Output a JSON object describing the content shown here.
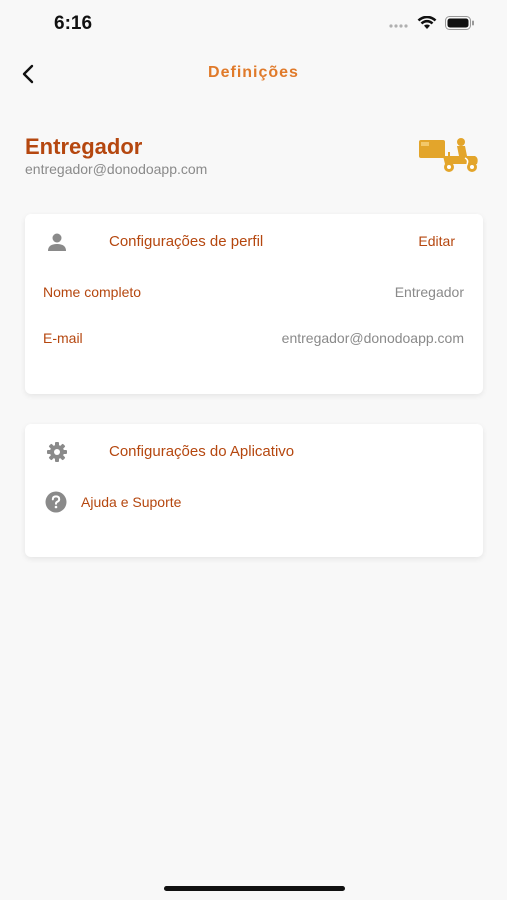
{
  "status_bar": {
    "time": "6:16"
  },
  "header": {
    "title": "Definições"
  },
  "profile": {
    "name": "Entregador",
    "email": "entregador@donodoapp.com"
  },
  "profile_card": {
    "title": "Configurações de perfil",
    "edit_label": "Editar",
    "fields": [
      {
        "label": "Nome completo",
        "value": "Entregador"
      },
      {
        "label": "E-mail",
        "value": "entregador@donodoapp.com"
      }
    ]
  },
  "app_card": {
    "title": "Configurações do Aplicativo",
    "items": [
      {
        "label": "Ajuda e Suporte",
        "icon": "help-circle-icon"
      }
    ]
  },
  "colors": {
    "accent": "#b5470f",
    "title_accent": "#e07a2a",
    "muted": "#8a8a8a",
    "background": "#f8f8f8",
    "logo": "#e3a52b"
  }
}
